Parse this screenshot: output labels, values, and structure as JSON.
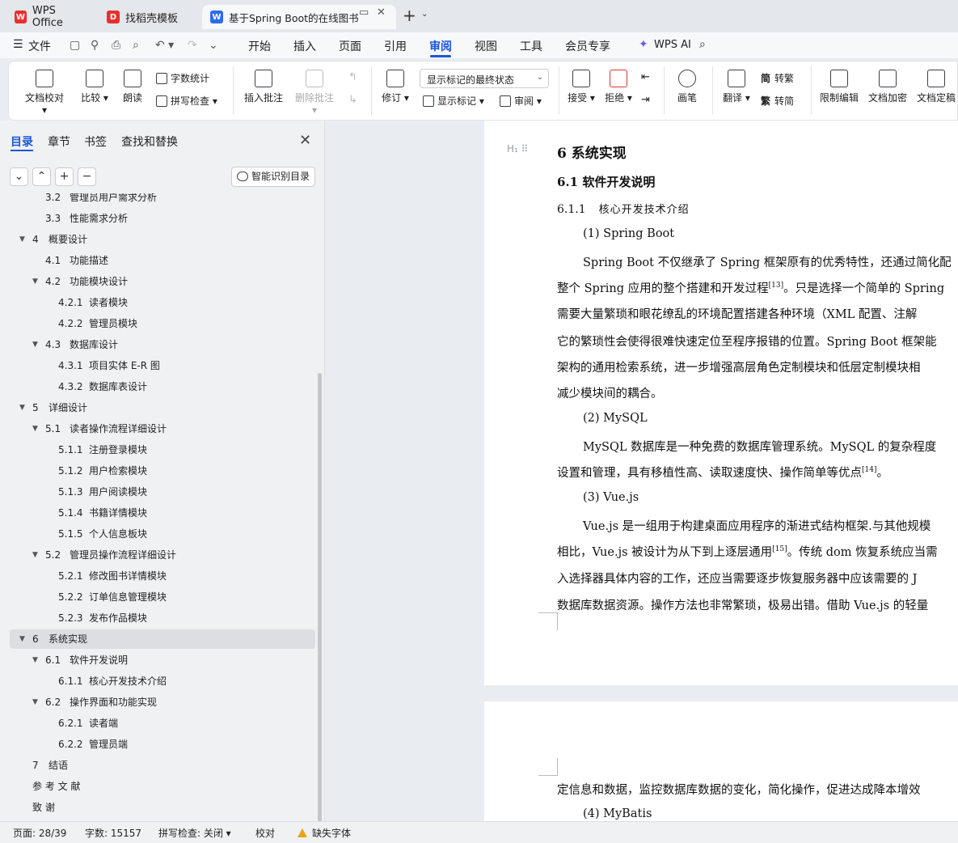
{
  "tabs": [
    {
      "label": "WPS Office",
      "icon": "wps-logo-icon",
      "color": "#e8302d"
    },
    {
      "label": "找稻壳模板",
      "icon": "docer-icon",
      "color": "#e8302d"
    },
    {
      "label": "基于Spring Boot的在线图书",
      "icon": "word-doc-icon",
      "color": "#2b6de8",
      "active": true
    }
  ],
  "menu": {
    "file": "文件",
    "items": [
      "开始",
      "插入",
      "页面",
      "引用",
      "审阅",
      "视图",
      "工具",
      "会员专享"
    ],
    "active": "审阅",
    "ai": "WPS AI"
  },
  "ribbon": {
    "doc_proof": "文档校对",
    "compare": "比较",
    "read_aloud": "朗读",
    "word_count": "字数统计",
    "spell_check": "拼写检查",
    "insert_comment": "插入批注",
    "delete_comment": "删除批注",
    "revise": "修订",
    "markup_state": "显示标记的最终状态",
    "show_markup": "显示标记",
    "review": "审阅",
    "accept": "接受",
    "reject": "拒绝",
    "pen": "画笔",
    "translate": "翻译",
    "to_traditional": "转繁",
    "to_simplified": "转简",
    "restrict_edit": "限制编辑",
    "doc_encrypt": "文档加密",
    "doc_finalize": "文档定稿",
    "trad_char": "简",
    "simp_char": "繁"
  },
  "panel": {
    "tabs": [
      "目录",
      "章节",
      "书签",
      "查找和替换"
    ],
    "smart_toc": "智能识别目录",
    "toc": [
      {
        "num": "3.2",
        "title": "管理员用户需求分析",
        "level": 2
      },
      {
        "num": "3.3",
        "title": "性能需求分析",
        "level": 2
      },
      {
        "num": "4",
        "title": "概要设计",
        "level": 1,
        "expanded": true
      },
      {
        "num": "4.1",
        "title": "功能描述",
        "level": 2
      },
      {
        "num": "4.2",
        "title": "功能模块设计",
        "level": 2,
        "expanded": true
      },
      {
        "num": "4.2.1",
        "title": "读者模块",
        "level": 3
      },
      {
        "num": "4.2.2",
        "title": "管理员模块",
        "level": 3
      },
      {
        "num": "4.3",
        "title": "数据库设计",
        "level": 2,
        "expanded": true
      },
      {
        "num": "4.3.1",
        "title": "项目实体 E-R 图",
        "level": 3
      },
      {
        "num": "4.3.2",
        "title": "数据库表设计",
        "level": 3
      },
      {
        "num": "5",
        "title": "详细设计",
        "level": 1,
        "expanded": true
      },
      {
        "num": "5.1",
        "title": "读者操作流程详细设计",
        "level": 2,
        "expanded": true
      },
      {
        "num": "5.1.1",
        "title": "注册登录模块",
        "level": 3
      },
      {
        "num": "5.1.2",
        "title": "用户检索模块",
        "level": 3
      },
      {
        "num": "5.1.3",
        "title": "用户阅读模块",
        "level": 3
      },
      {
        "num": "5.1.4",
        "title": "书籍详情模块",
        "level": 3
      },
      {
        "num": "5.1.5",
        "title": "个人信息板块",
        "level": 3
      },
      {
        "num": "5.2",
        "title": "管理员操作流程详细设计",
        "level": 2,
        "expanded": true
      },
      {
        "num": "5.2.1",
        "title": "修改图书详情模块",
        "level": 3
      },
      {
        "num": "5.2.2",
        "title": "订单信息管理模块",
        "level": 3
      },
      {
        "num": "5.2.3",
        "title": "发布作品模块",
        "level": 3
      },
      {
        "num": "6",
        "title": "系统实现",
        "level": 1,
        "expanded": true,
        "selected": true
      },
      {
        "num": "6.1",
        "title": "软件开发说明",
        "level": 2,
        "expanded": true
      },
      {
        "num": "6.1.1",
        "title": "核心开发技术介绍",
        "level": 3
      },
      {
        "num": "6.2",
        "title": "操作界面和功能实现",
        "level": 2,
        "expanded": true
      },
      {
        "num": "6.2.1",
        "title": "读者端",
        "level": 3
      },
      {
        "num": "6.2.2",
        "title": "管理员端",
        "level": 3
      },
      {
        "num": "7",
        "title": "结语",
        "level": 1
      },
      {
        "num": "",
        "title": "参 考 文 献",
        "level": 1
      },
      {
        "num": "",
        "title": "致    谢",
        "level": 1
      }
    ]
  },
  "document": {
    "h1": "6   系统实现",
    "h2": "6.1   软件开发说明",
    "h3_num": "6.1.1",
    "h3_title": "核心开发技术介绍",
    "s1": "(1)  Spring Boot",
    "p1_l1": "Spring Boot 不仅继承了 Spring 框架原有的优秀特性，还通过简化配",
    "p1_l2a": "整个 Spring 应用的整个搭建和开发过程",
    "p1_l2_ref": "[13]",
    "p1_l2b": "。只是选择一个简单的 Spring",
    "p1_l3": "需要大量繁琐和眼花缭乱的环境配置搭建各种环境（XML 配置、注解",
    "p1_l4": "它的繁琐性会使得很难快速定位至程序报错的位置。Spring Boot 框架能",
    "p1_l5": "架构的通用检索系统，进一步增强高层角色定制模块和低层定制模块相",
    "p1_l6": "减少模块间的耦合。",
    "s2": "(2)  MySQL",
    "p2_l1": "MySQL 数据库是一种免费的数据库管理系统。MySQL 的复杂程度",
    "p2_l2a": "设置和管理，具有移植性高、读取速度快、操作简单等优点",
    "p2_l2_ref": "[14]",
    "p2_l2b": "。",
    "s3": "(3)  Vue.js",
    "p3_l1": "Vue.js 是一组用于构建桌面应用程序的渐进式结构框架.与其他规模",
    "p3_l2a": "相比，Vue.js 被设计为从下到上逐层通用",
    "p3_l2_ref": "[15]",
    "p3_l2b": "。传统 dom 恢复系统应当需",
    "p3_l3": "入选择器具体内容的工作，还应当需要逐步恢复服务器中应该需要的 J",
    "p3_l4": "数据库数据资源。操作方法也非常繁琐，极易出错。借助 Vue.js 的轻量",
    "p4_l1": "定信息和数据，监控数据库数据的变化，简化操作，促进达成降本增效",
    "s4": "(4)  MyBatis"
  },
  "status": {
    "page": "页面: 28/39",
    "words": "字数: 15157",
    "spell": "拼写检查: 关闭",
    "proof": "校对",
    "missing_font": "缺失字体"
  }
}
